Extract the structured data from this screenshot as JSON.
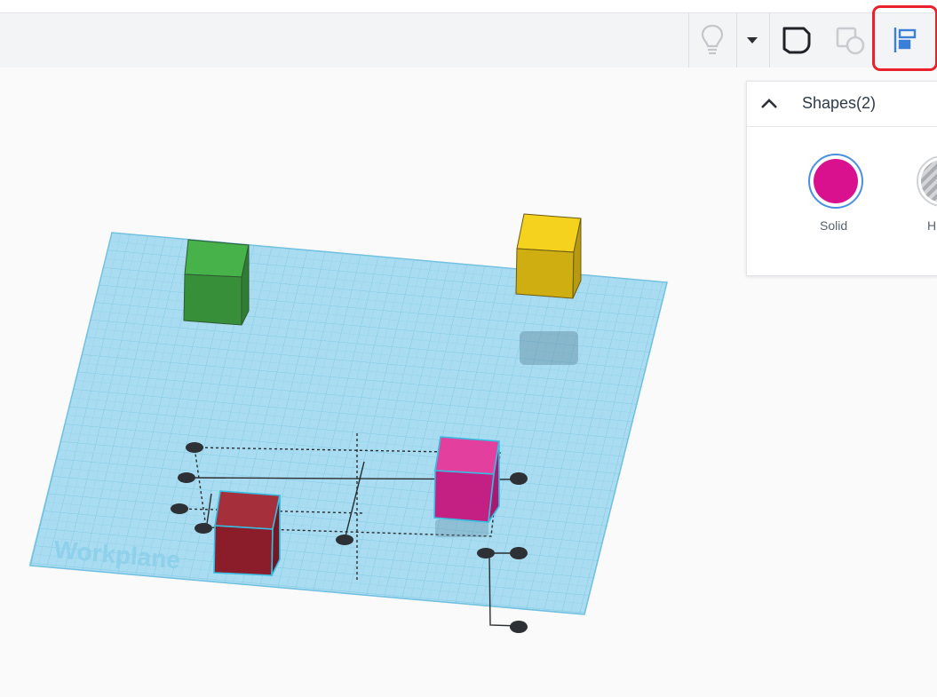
{
  "canvas": {
    "workplane_label": "Workplane"
  },
  "toolbar": {
    "items": [
      {
        "name": "hint-lightbulb",
        "icon": "lightbulb-icon"
      },
      {
        "name": "dropdown",
        "icon": "caret-down-icon"
      },
      {
        "name": "note",
        "icon": "note-shape-icon"
      },
      {
        "name": "group",
        "icon": "group-shapes-icon"
      },
      {
        "name": "align",
        "icon": "align-icon"
      }
    ]
  },
  "shapes_panel": {
    "title": "Shapes(2)",
    "solid_label": "Solid",
    "hole_label": "H",
    "solid_color": "#d9118f"
  },
  "colors": {
    "green_box": "#3fa243",
    "yellow_box": "#f2cd19",
    "pink_box": "#d6228e",
    "red_box": "#8f1e2a",
    "workplane": "#a9dcf0",
    "highlight": "#e8212c"
  }
}
